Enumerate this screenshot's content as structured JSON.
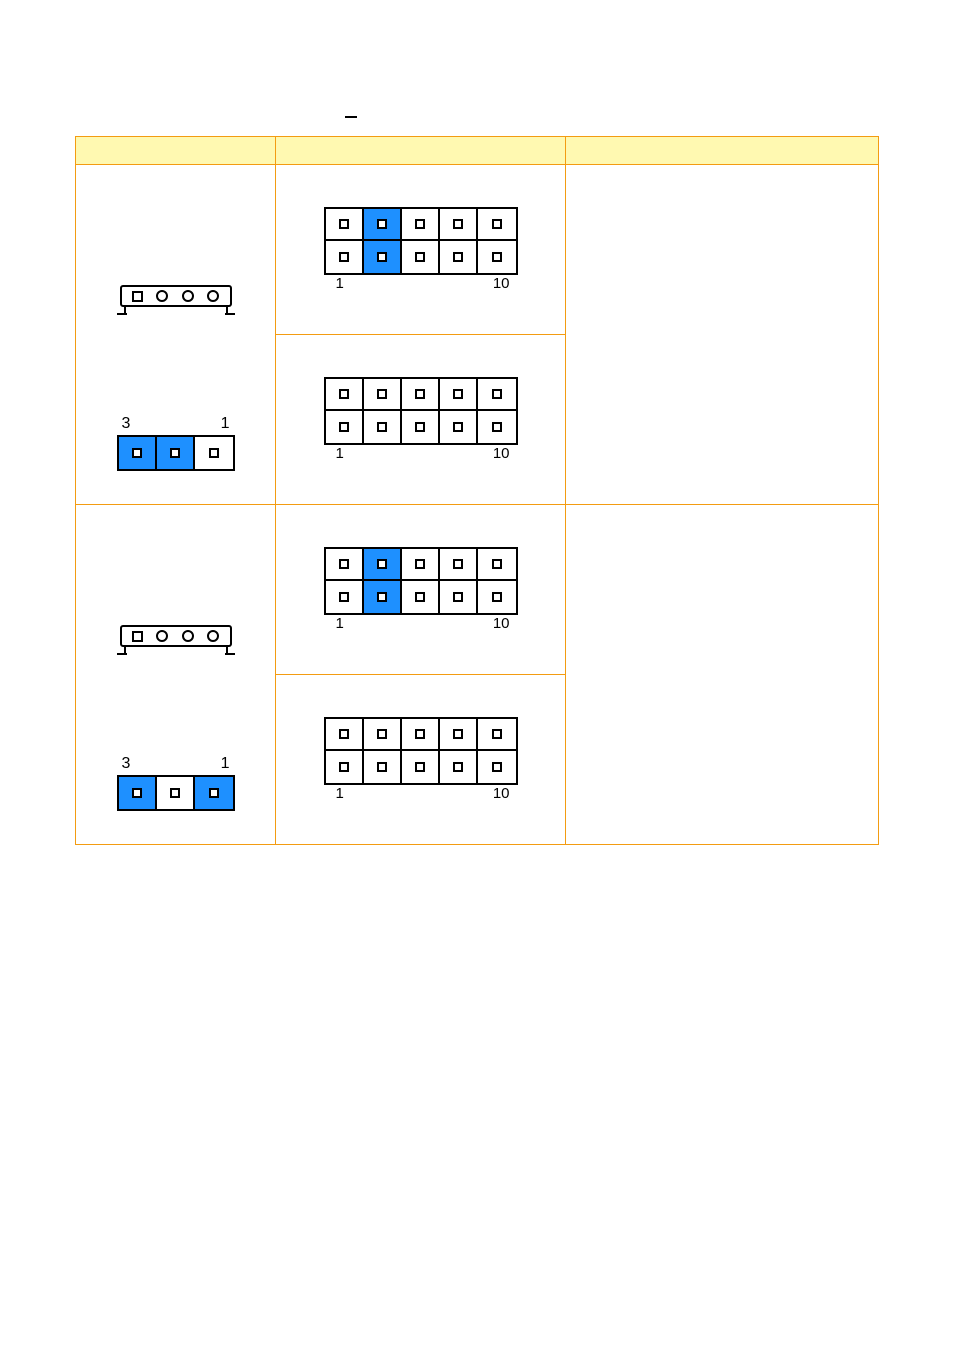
{
  "table": {
    "headers": [
      "",
      "",
      ""
    ]
  },
  "rows": [
    {
      "tileLabels": {
        "left": "3",
        "right": "1"
      },
      "tilePattern": [
        "on",
        "on",
        "off"
      ],
      "maps": [
        {
          "labels": {
            "left": "1",
            "right": "10"
          },
          "blue": [
            2,
            7
          ]
        },
        {
          "labels": {
            "left": "1",
            "right": "10"
          },
          "blue": []
        }
      ]
    },
    {
      "tileLabels": {
        "left": "3",
        "right": "1"
      },
      "tilePattern": [
        "on",
        "off",
        "on"
      ],
      "maps": [
        {
          "labels": {
            "left": "1",
            "right": "10"
          },
          "blue": [
            2,
            7
          ]
        },
        {
          "labels": {
            "left": "1",
            "right": "10"
          },
          "blue": []
        }
      ]
    }
  ]
}
